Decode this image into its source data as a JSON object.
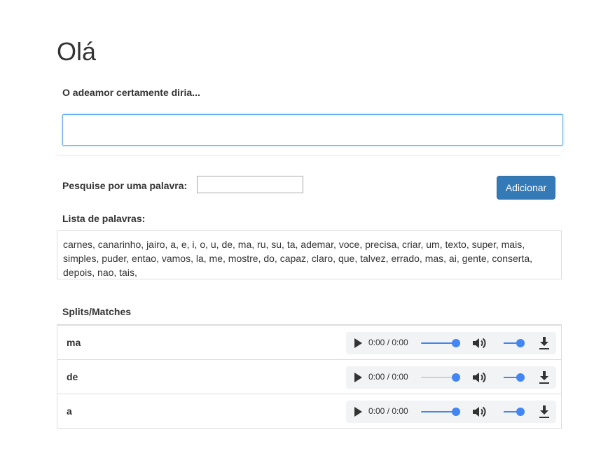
{
  "title": "Olá",
  "prompt_label": "O adeamor certamente diria...",
  "main_input": {
    "value": "",
    "placeholder": ""
  },
  "search": {
    "label": "Pesquise por uma palavra:",
    "value": ""
  },
  "add_button": "Adicionar",
  "word_list": {
    "label": "Lista de palavras:",
    "text": "carnes, canarinho, jairo, a, e, i, o, u, de, ma, ru, su, ta, ademar, voce, precisa, criar, um, texto, super, mais, simples, puder, entao, vamos, la, me, mostre, do, capaz, claro, que, talvez, errado, mas, ai, gente, conserta, depois, nao, tais,"
  },
  "splits": {
    "label": "Splits/Matches",
    "rows": [
      {
        "word": "ma",
        "time": "0:00 / 0:00",
        "progress_track_active": true
      },
      {
        "word": "de",
        "time": "0:00 / 0:00",
        "progress_track_active": false
      },
      {
        "word": "a",
        "time": "0:00 / 0:00",
        "progress_track_active": true
      }
    ]
  },
  "colors": {
    "accent": "#337ab7",
    "slider": "#4285f4",
    "slider_inactive": "#d0d0d0"
  },
  "icons": [
    "play-icon",
    "speaker-icon",
    "download-icon"
  ]
}
